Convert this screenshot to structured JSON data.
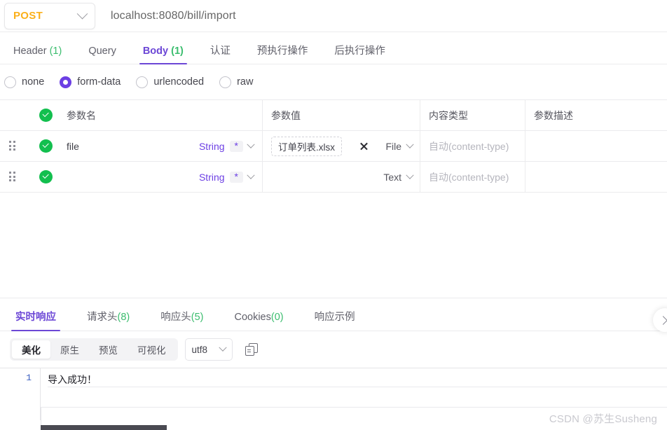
{
  "urlbar": {
    "method": "POST",
    "method_caret": "chevron-down",
    "url": "localhost:8080/bill/import"
  },
  "request_tabs": [
    {
      "label": "Header ",
      "count": "(1)",
      "active": false
    },
    {
      "label": "Query",
      "count": "",
      "active": false
    },
    {
      "label": "Body ",
      "count": "(1)",
      "active": true
    },
    {
      "label": "认证",
      "count": "",
      "active": false
    },
    {
      "label": "预执行操作",
      "count": "",
      "active": false
    },
    {
      "label": "后执行操作",
      "count": "",
      "active": false
    }
  ],
  "body_type": {
    "options": [
      {
        "label": "none",
        "selected": false
      },
      {
        "label": "form-data",
        "selected": true
      },
      {
        "label": "urlencoded",
        "selected": false
      },
      {
        "label": "raw",
        "selected": false
      }
    ]
  },
  "param_table": {
    "headers": {
      "name": "参数名",
      "value": "参数值",
      "content_type": "内容类型",
      "description": "参数描述"
    },
    "rows": [
      {
        "enabled": true,
        "name": "file",
        "name_placeholder": "",
        "type": "String",
        "required_badge": "*",
        "value_file": "订单列表.xlsx",
        "value_mode": "File",
        "content_type_placeholder": "自动(content-type)",
        "description": ""
      },
      {
        "enabled": true,
        "name": "",
        "name_placeholder": "",
        "type": "String",
        "required_badge": "*",
        "value_file": "",
        "value_mode": "Text",
        "content_type_placeholder": "自动(content-type)",
        "description": ""
      }
    ]
  },
  "response": {
    "tabs": [
      {
        "label": "实时响应",
        "count": "",
        "active": true
      },
      {
        "label": "请求头",
        "count": "(8)",
        "active": false
      },
      {
        "label": "响应头",
        "count": "(5)",
        "active": false
      },
      {
        "label": "Cookies",
        "count": "(0)",
        "active": false
      },
      {
        "label": "响应示例",
        "count": "",
        "active": false
      }
    ],
    "view_modes": [
      {
        "label": "美化",
        "active": true
      },
      {
        "label": "原生",
        "active": false
      },
      {
        "label": "预览",
        "active": false
      },
      {
        "label": "可视化",
        "active": false
      }
    ],
    "encoding": "utf8",
    "copy_icon": "copy-icon",
    "body": {
      "line_numbers": [
        "1"
      ],
      "lines": [
        "导入成功！"
      ]
    }
  },
  "watermark": "CSDN @苏生Susheng",
  "colors": {
    "accent": "#6c3fe4",
    "method": "#fbb01a",
    "success": "#12bf4e",
    "count": "#3bbd6e"
  }
}
